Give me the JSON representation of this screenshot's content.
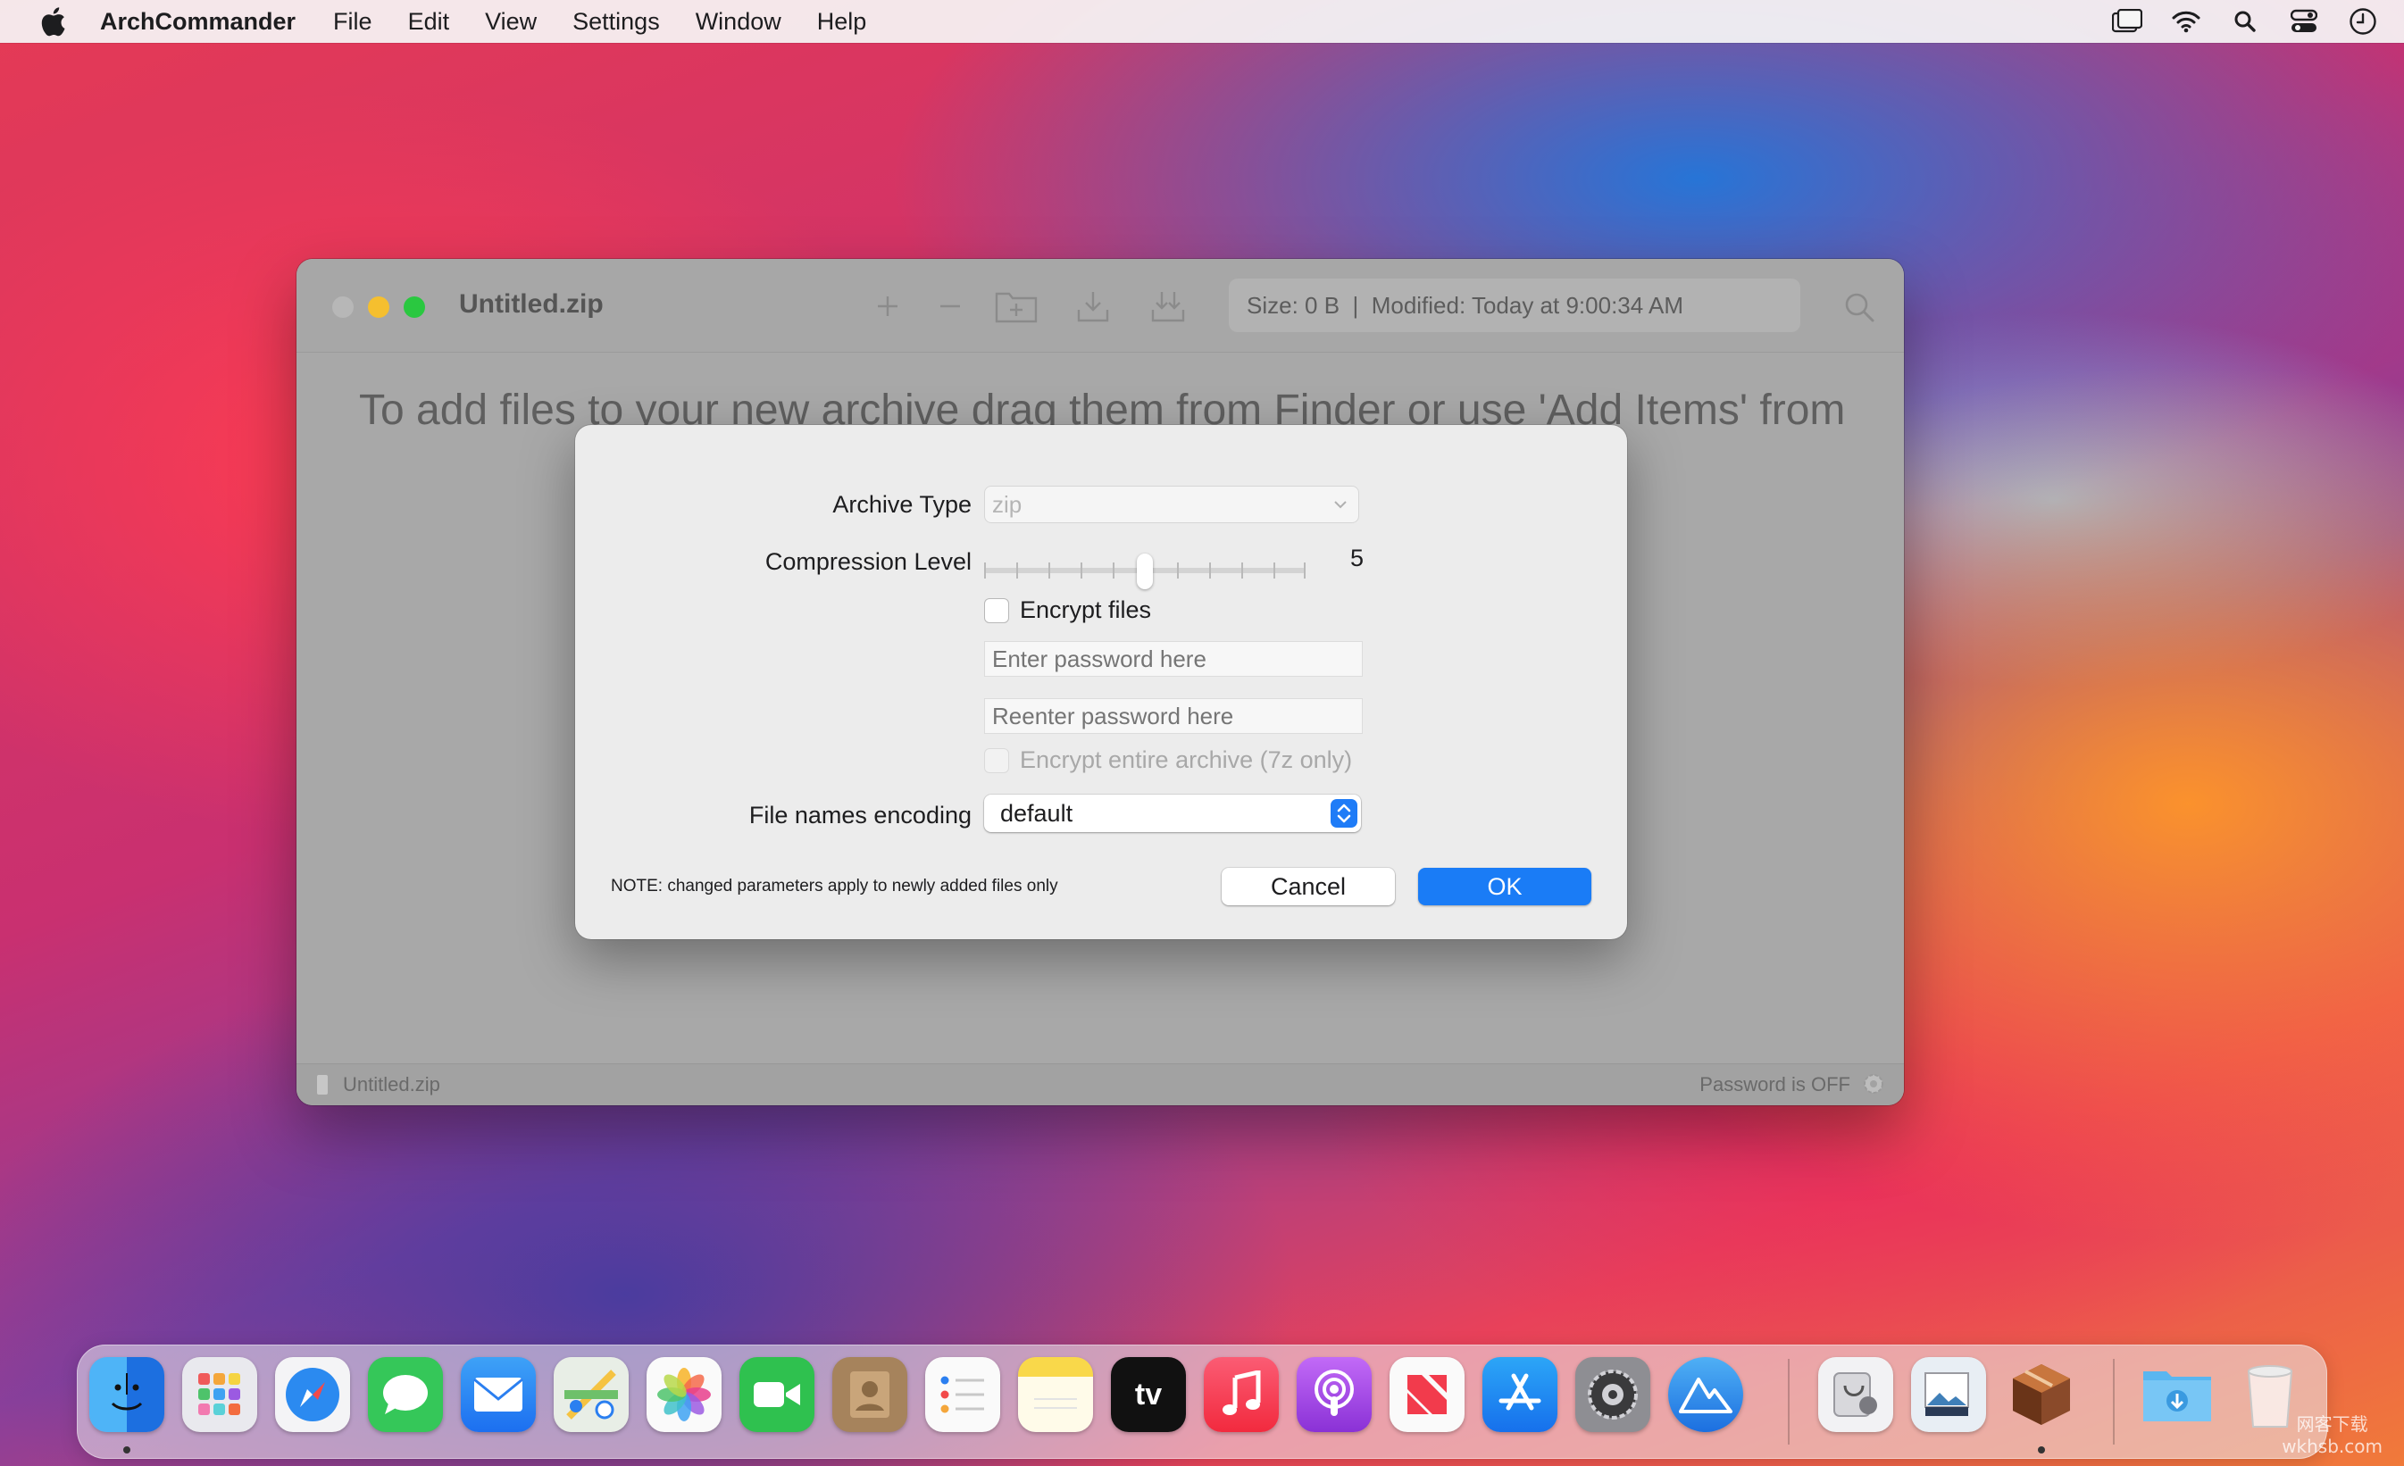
{
  "menubar": {
    "app_name": "ArchCommander",
    "items": [
      "File",
      "Edit",
      "View",
      "Settings",
      "Window",
      "Help"
    ],
    "status_icons": [
      "display-icon",
      "wifi-icon",
      "search-icon",
      "control-center-icon",
      "clock-icon"
    ]
  },
  "window": {
    "title": "Untitled.zip",
    "toolbar": [
      "add-icon",
      "remove-icon",
      "new-folder-icon",
      "extract-icon",
      "extract-all-icon"
    ],
    "info": "Size: 0 B  |  Modified: Today at 9:00:34 AM",
    "hint": "To add files to your new archive drag them from Finder or use 'Add Items' from",
    "status_filename": "Untitled.zip",
    "status_password": "Password is OFF"
  },
  "dialog": {
    "archive_type_label": "Archive Type",
    "archive_type_value": "zip",
    "compression_label": "Compression Level",
    "compression_value": "5",
    "compression_level": 5,
    "compression_max": 10,
    "encrypt_label": "Encrypt files",
    "password_placeholder": "Enter password here",
    "repassword_placeholder": "Reenter password here",
    "encrypt_archive_label": "Encrypt entire archive (7z only)",
    "encoding_label": "File names encoding",
    "encoding_value": "default",
    "note": "NOTE: changed parameters apply to newly added files only",
    "cancel": "Cancel",
    "ok": "OK"
  },
  "dock": {
    "apps": [
      "finder-icon",
      "launchpad-icon",
      "safari-icon",
      "messages-icon",
      "mail-icon",
      "maps-icon",
      "photos-icon",
      "facetime-icon",
      "contacts-icon",
      "reminders-icon",
      "notes-icon",
      "tv-icon",
      "music-icon",
      "podcasts-icon",
      "news-icon",
      "app-store-icon",
      "system-preferences-icon",
      "altimeter-icon",
      "disk-utility-icon",
      "preview-icon",
      "archcommander-icon",
      "downloads-folder-icon",
      "trash-icon"
    ],
    "tv_label": "tv",
    "colors": {
      "finder": "#2a8fe8",
      "safari": "#2b8af0",
      "messages": "#35c759",
      "mail": "#2b7ff0",
      "facetime": "#2fc14f",
      "music": "#f24a5d",
      "podcasts": "#a44ae0",
      "news": "#f23b4c",
      "appstore": "#1b8cf5",
      "tv": "#111111",
      "contacts": "#a6835c",
      "notes": "#f9d84a"
    }
  },
  "watermark": "网客下载\nwkhsb.com"
}
